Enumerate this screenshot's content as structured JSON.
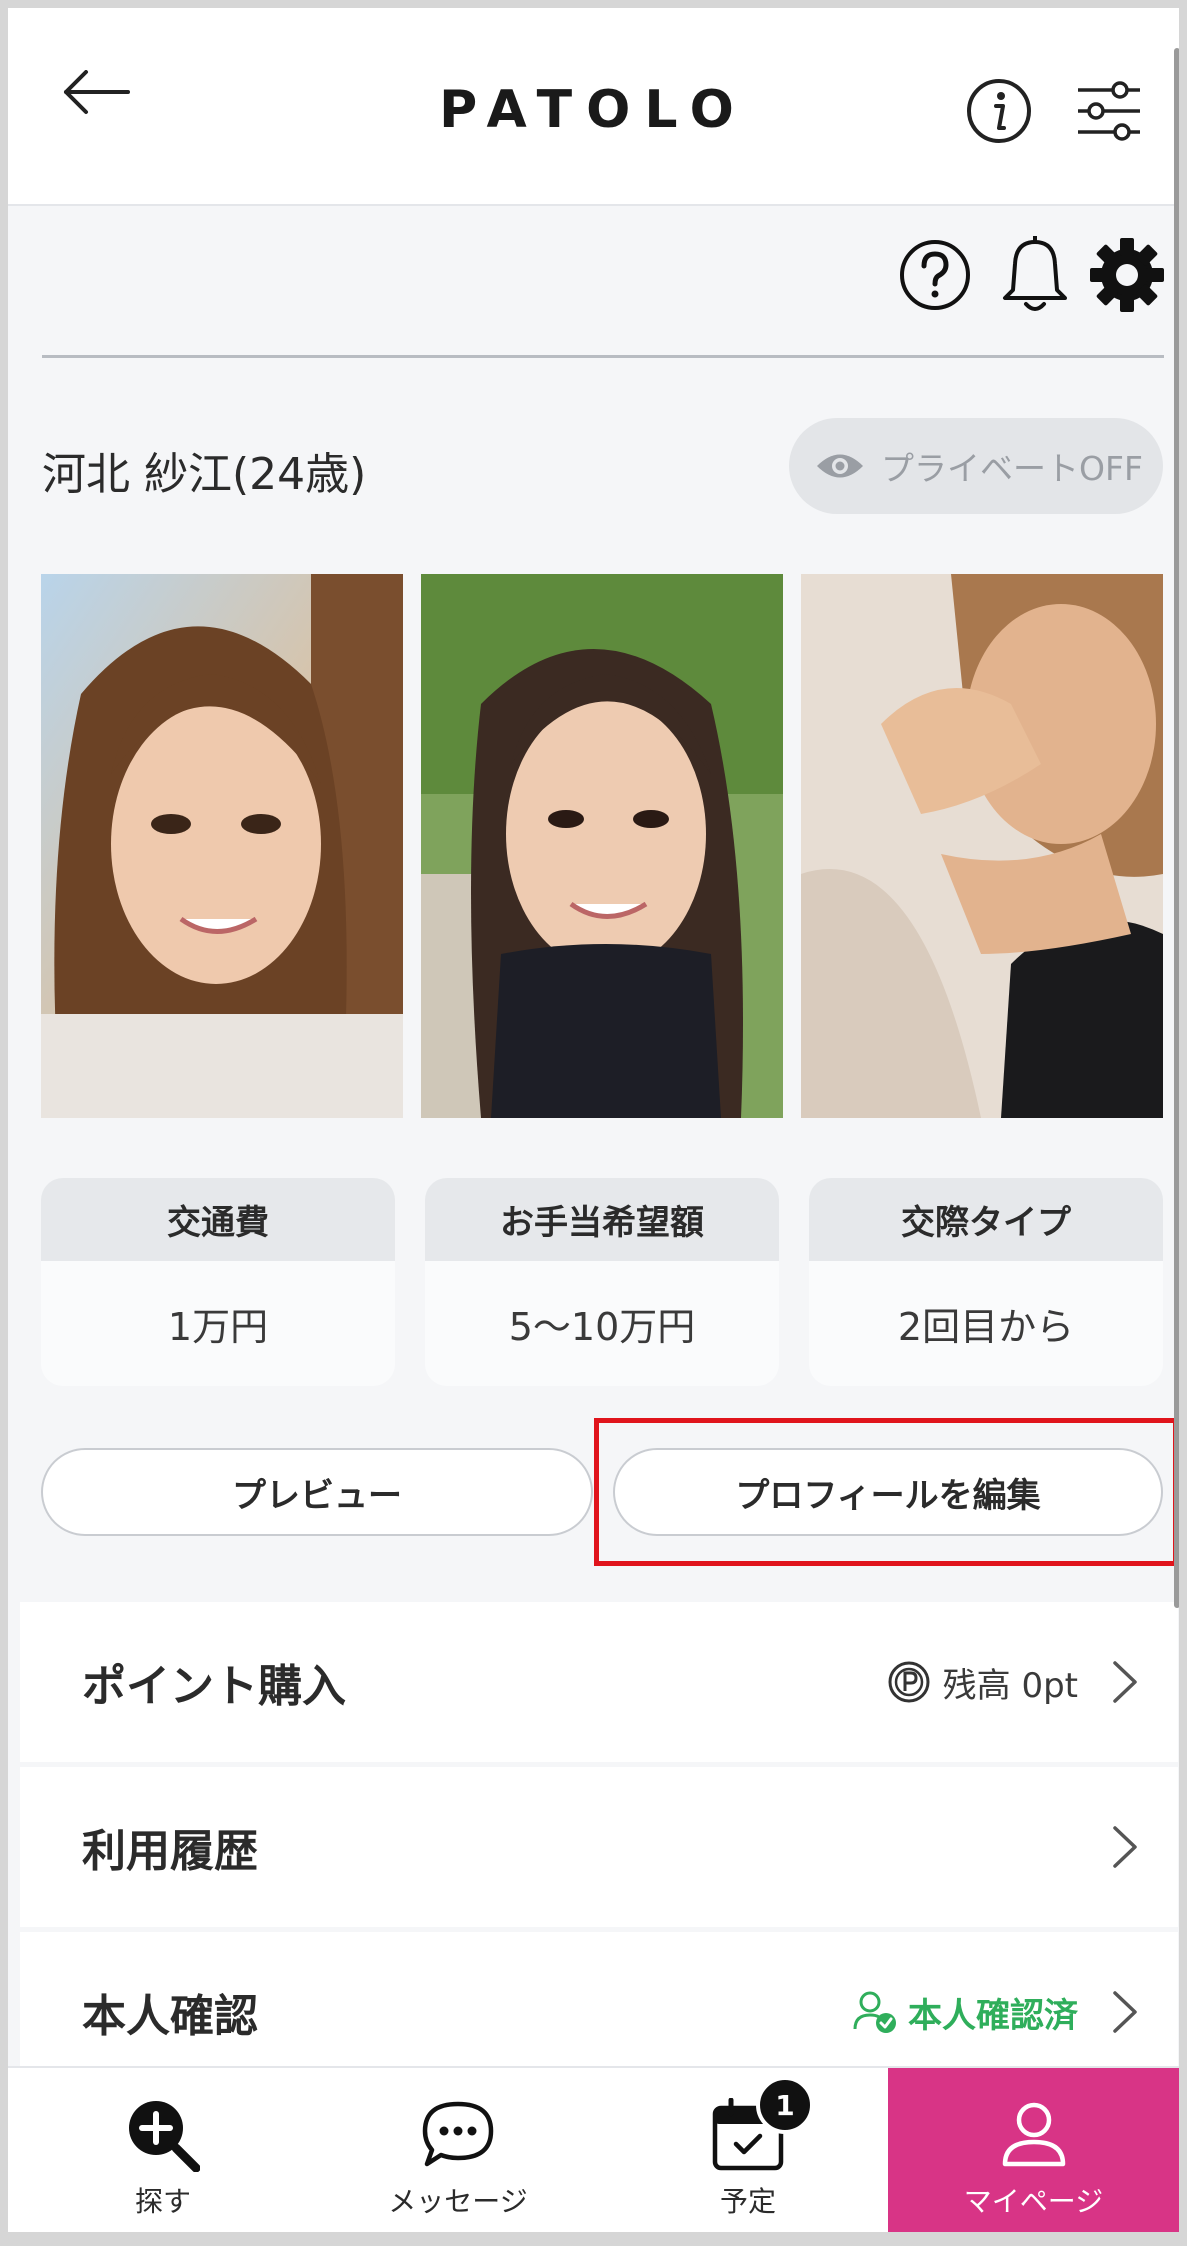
{
  "header": {
    "logo": "PATOLO"
  },
  "profile": {
    "name": "河北 紗江(24歳)",
    "private_toggle": "プライベートOFF"
  },
  "cards": [
    {
      "title": "交通費",
      "value": "1万円"
    },
    {
      "title": "お手当希望額",
      "value": "5〜10万円"
    },
    {
      "title": "交際タイプ",
      "value": "2回目から"
    }
  ],
  "buttons": {
    "preview": "プレビュー",
    "edit_profile": "プロフィールを編集"
  },
  "menu": {
    "points": {
      "label": "ポイント購入",
      "balance": "残高 0pt"
    },
    "history": {
      "label": "利用履歴"
    },
    "verification": {
      "label": "本人確認",
      "status": "本人確認済"
    }
  },
  "bottom_nav": {
    "search": "探す",
    "messages": "メッセージ",
    "schedule": "予定",
    "schedule_badge": "1",
    "mypage": "マイページ"
  },
  "colors": {
    "accent": "#d83486",
    "verified": "#2fae5b",
    "highlight": "#e0141c"
  }
}
